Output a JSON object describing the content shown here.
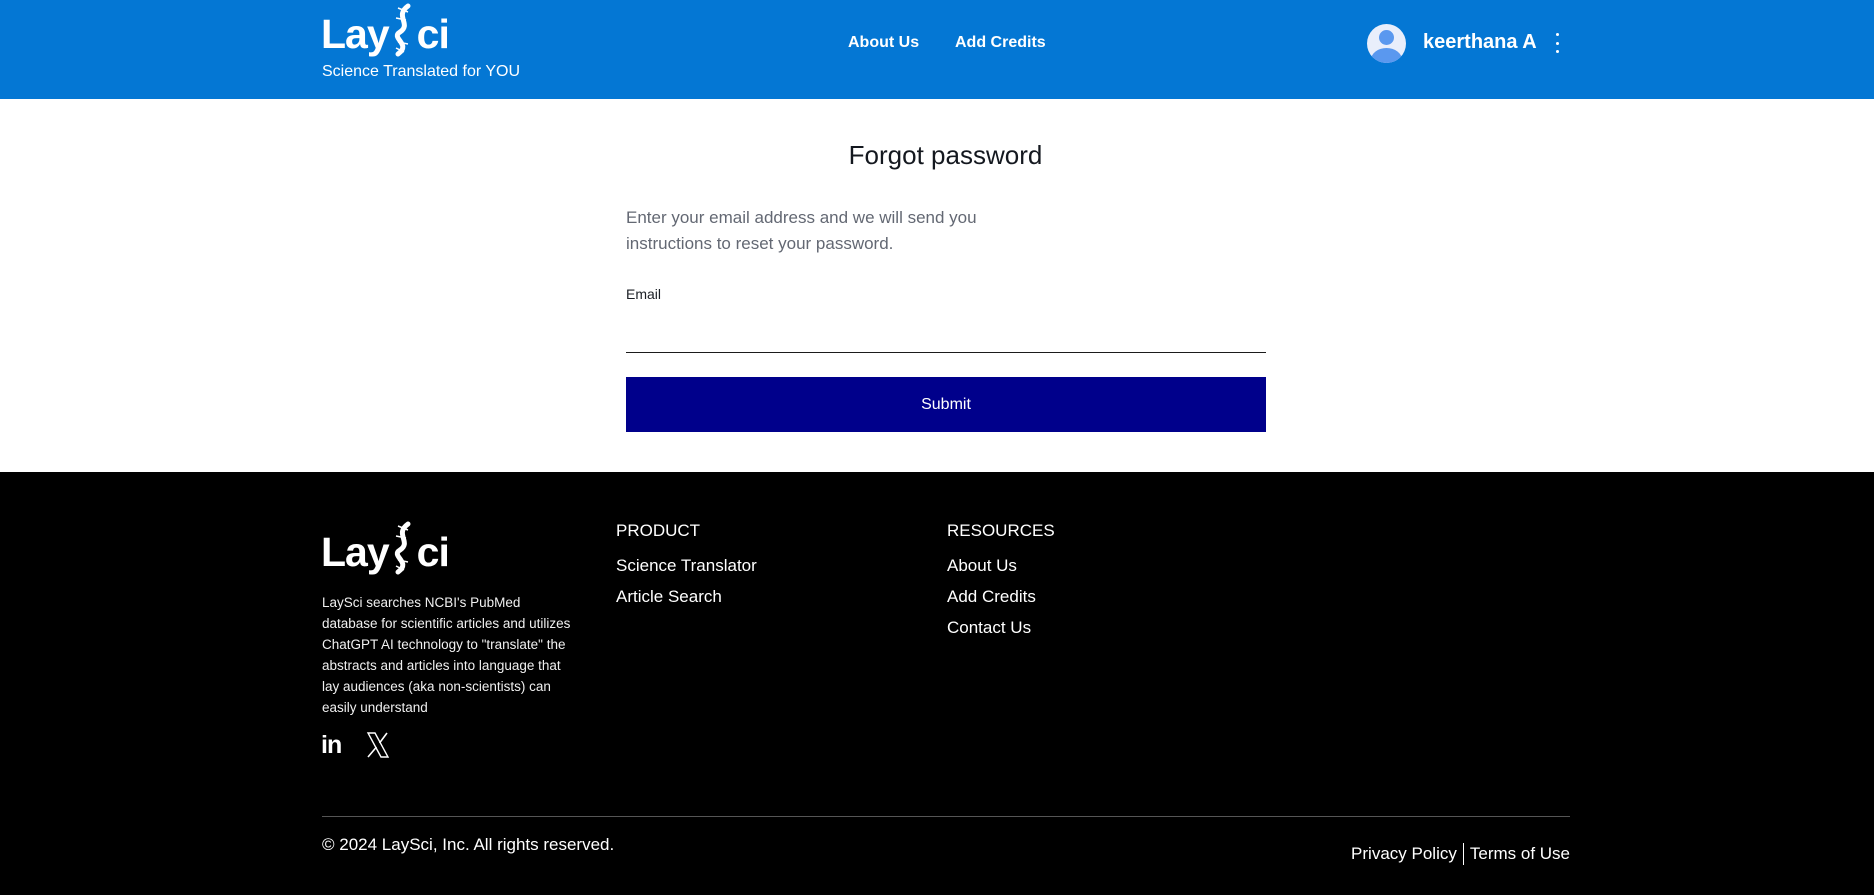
{
  "header": {
    "logo_left": "Lay",
    "logo_right": "ci",
    "tagline": "Science Translated for YOU",
    "nav": [
      "About Us",
      "Add Credits"
    ],
    "user_name": "keerthana A",
    "brand_color": "#0477d4"
  },
  "form": {
    "title": "Forgot password",
    "description": "Enter your email address and we will send you instructions to reset your password.",
    "email_label": "Email",
    "email_value": "",
    "submit_label": "Submit",
    "submit_color": "#00008b"
  },
  "footer": {
    "logo_left": "Lay",
    "logo_right": "ci",
    "description": "LaySci searches NCBI's PubMed database for scientific articles and utilizes ChatGPT AI technology to \"translate\" the abstracts and articles into language that lay audiences (aka non-scientists) can easily understand",
    "social": [
      "linkedin-icon",
      "x-twitter-icon"
    ],
    "linkedin_glyph": "in",
    "product": {
      "heading": "PRODUCT",
      "links": [
        "Science Translator",
        "Article Search"
      ]
    },
    "resources": {
      "heading": "RESOURCES",
      "links": [
        "About Us",
        "Add Credits",
        "Contact Us"
      ]
    },
    "copyright": "© 2024 LaySci, Inc. All rights reserved.",
    "privacy": "Privacy Policy",
    "terms": "Terms of Use"
  }
}
